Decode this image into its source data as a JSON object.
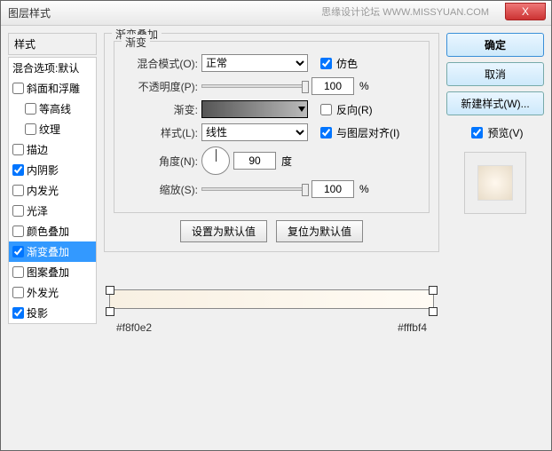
{
  "window": {
    "title": "图层样式"
  },
  "watermark": "思缘设计论坛  WWW.MISSYUAN.COM",
  "close_x": "X",
  "left": {
    "header": "样式",
    "blending": "混合选项:默认",
    "items": [
      {
        "label": "斜面和浮雕",
        "checked": false
      },
      {
        "label": "等高线",
        "checked": false,
        "child": true
      },
      {
        "label": "纹理",
        "checked": false,
        "child": true
      },
      {
        "label": "描边",
        "checked": false
      },
      {
        "label": "内阴影",
        "checked": true
      },
      {
        "label": "内发光",
        "checked": false
      },
      {
        "label": "光泽",
        "checked": false
      },
      {
        "label": "颜色叠加",
        "checked": false
      },
      {
        "label": "渐变叠加",
        "checked": true,
        "selected": true
      },
      {
        "label": "图案叠加",
        "checked": false
      },
      {
        "label": "外发光",
        "checked": false
      },
      {
        "label": "投影",
        "checked": true
      }
    ]
  },
  "center": {
    "outer_legend": "渐变叠加",
    "inner_legend": "渐变",
    "blend_mode_label": "混合模式(O):",
    "blend_mode_value": "正常",
    "dither_label": "仿色",
    "opacity_label": "不透明度(P):",
    "opacity_value": "100",
    "percent": "%",
    "gradient_label": "渐变:",
    "reverse_label": "反向(R)",
    "style_label": "样式(L):",
    "style_value": "线性",
    "align_label": "与图层对齐(I)",
    "angle_label": "角度(N):",
    "angle_value": "90",
    "degree": "度",
    "scale_label": "缩放(S):",
    "scale_value": "100",
    "btn_default": "设置为默认值",
    "btn_reset": "复位为默认值",
    "color_left": "#f8f0e2",
    "color_right": "#fffbf4"
  },
  "right": {
    "ok": "确定",
    "cancel": "取消",
    "new_style": "新建样式(W)...",
    "preview_label": "预览(V)"
  }
}
